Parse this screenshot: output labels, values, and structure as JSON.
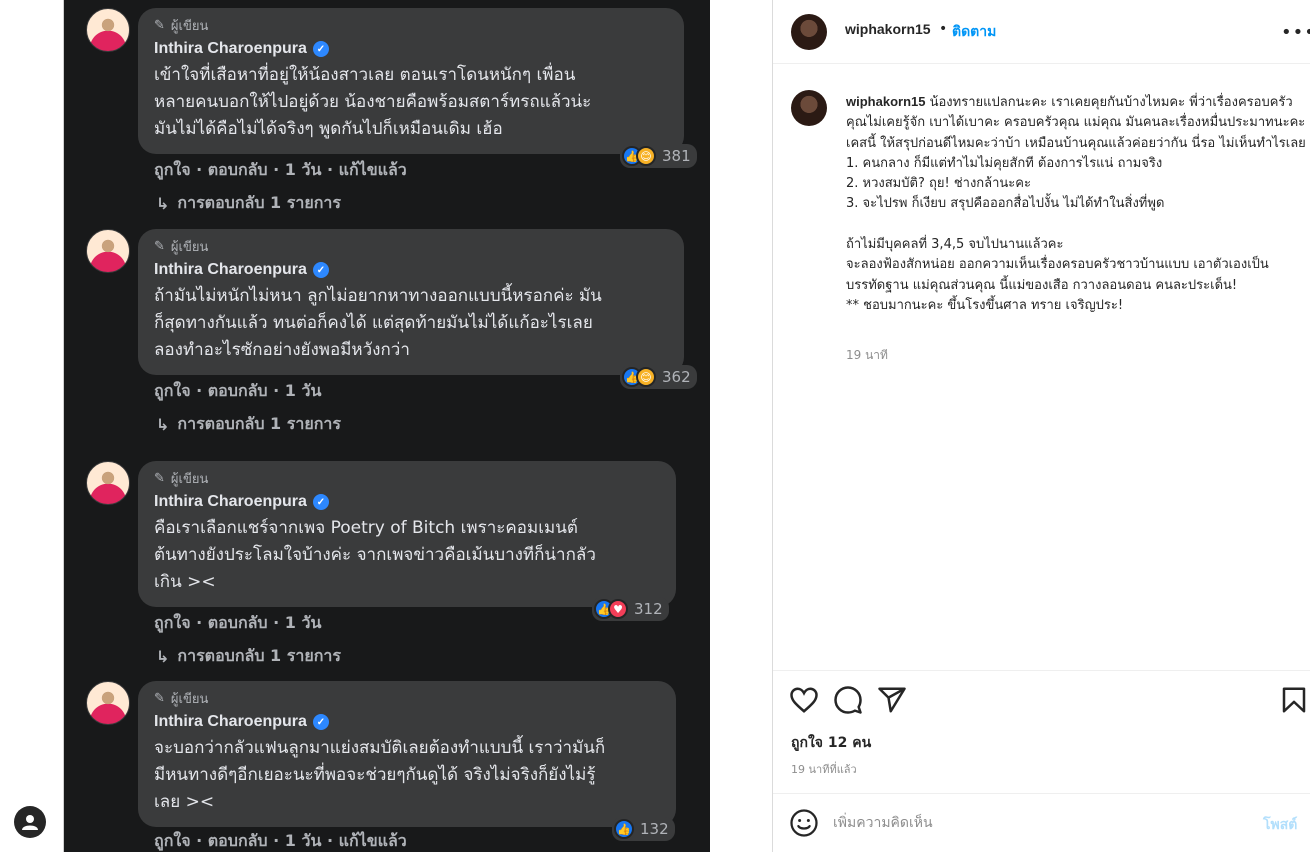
{
  "fb_screenshot": {
    "comments": [
      {
        "badge": "ผู้เขียน",
        "author": "Inthira Charoenpura",
        "lines": [
          "เข้าใจที่เสือหาที่อยู่ให้น้องสาวเลย ตอนเราโดนหนักๆ เพื่อน",
          "หลายคนบอกให้ไปอยู่ด้วย น้องชายคือพร้อมสตาร์ทรถแล้วน่ะ",
          "มันไม่ได้คือไม่ได้จริงๆ พูดกันไปก็เหมือนเดิม เฮ้อ"
        ],
        "reactions": "381",
        "actions": "ถูกใจ · ตอบกลับ · 1 วัน · แก้ไขแล้ว",
        "replies": "การตอบกลับ 1 รายการ"
      },
      {
        "badge": "ผู้เขียน",
        "author": "Inthira Charoenpura",
        "lines": [
          "ถ้ามันไม่หนักไม่หนา ลูกไม่อยากหาทางออกแบบนี้หรอกค่ะ มัน",
          "ก็สุดทางกันแล้ว ทนต่อก็คงได้ แต่สุดท้ายมันไม่ได้แก้อะไรเลย",
          "ลองทำอะไรซักอย่างยังพอมีหวังกว่า"
        ],
        "reactions": "362",
        "actions": "ถูกใจ · ตอบกลับ · 1 วัน",
        "replies": "การตอบกลับ 1 รายการ"
      },
      {
        "badge": "ผู้เขียน",
        "author": "Inthira Charoenpura",
        "lines": [
          "คือเราเลือกแชร์จากเพจ Poetry of Bitch เพราะคอมเมนต์",
          "ต้นทางยังประโลมใจบ้างค่ะ จากเพจข่าวคือเม้นบางทีก็น่ากลัว",
          "เกิน ><"
        ],
        "reactions": "312",
        "actions": "ถูกใจ · ตอบกลับ · 1 วัน",
        "replies": "การตอบกลับ 1 รายการ"
      },
      {
        "badge": "ผู้เขียน",
        "author": "Inthira Charoenpura",
        "lines": [
          "จะบอกว่ากลัวแฟนลูกมาแย่งสมบัติเลยต้องทำแบบนี้ เราว่ามันก็",
          "มีหนทางดีๆอีกเยอะนะที่พอจะช่วยๆกันดูได้ จริงไม่จริงก็ยังไม่รู้",
          "เลย ><"
        ],
        "reactions": "132",
        "actions": "ถูกใจ · ตอบกลับ · 1 วัน · แก้ไขแล้ว",
        "replies": ""
      }
    ]
  },
  "ig": {
    "username": "wiphakorn15",
    "dot": "•",
    "follow": "ติดตาม",
    "more": "•••",
    "caption_username": "wiphakorn15",
    "caption_first": "น้องทรายแปลกนะคะ เราเคยคุยกันบ้างไหมคะ พี่ว่าเรื่องครอบครัว คุณไม่เคยรู้จัก เบาได้เบาคะ ครอบครัวคุณ แม่คุณ มันคนละเรื่องหมื่นประมาทนะคะ เคสนี้ ให้สรุปก่อนดีไหมคะว่าบ้า เหมือนบ้านคุณแล้วค่อยว่ากัน นี่รอ ไม่เห็นทำไรเลย",
    "caption_rest": "1. คนกลาง ก็มีแต่ทำไมไม่คุยสักที ต้องการไรแน่ ถามจริง\n2. หวงสมบัติ? ถุย! ช่างกล้านะคะ\n3. จะไปรพ ก็เงียบ สรุปคือออกสื่อไปงั้น ไม่ได้ทำในสิ่งที่พูด\n\nถ้าไม่มีบุคคลที่ 3,4,5 จบไปนานแล้วคะ\nจะลองฟ้องสักหน่อย ออกความเห็นเรื่องครอบครัวชาวบ้านแบบ เอาตัวเองเป็นบรรทัดฐาน แม่คุณส่วนคุณ นี้แม่ของเสือ กวางลอนดอน คนละประเด็น!\n** ชอบมากนะคะ ขึ้นโรงขึ้นศาล ทราย เจริญประ!",
    "caption_time": "19 นาที",
    "likes": "ถูกใจ 12 คน",
    "post_time": "19 นาทีที่แล้ว",
    "comment_placeholder": "เพิ่มความคิดเห็น",
    "post_label": "โพสต์"
  },
  "colors": {
    "follow": "#0095f6",
    "fb_bg": "#18191a",
    "fb_bubble": "#3a3b3c",
    "post_disabled": "#b2dffc"
  }
}
